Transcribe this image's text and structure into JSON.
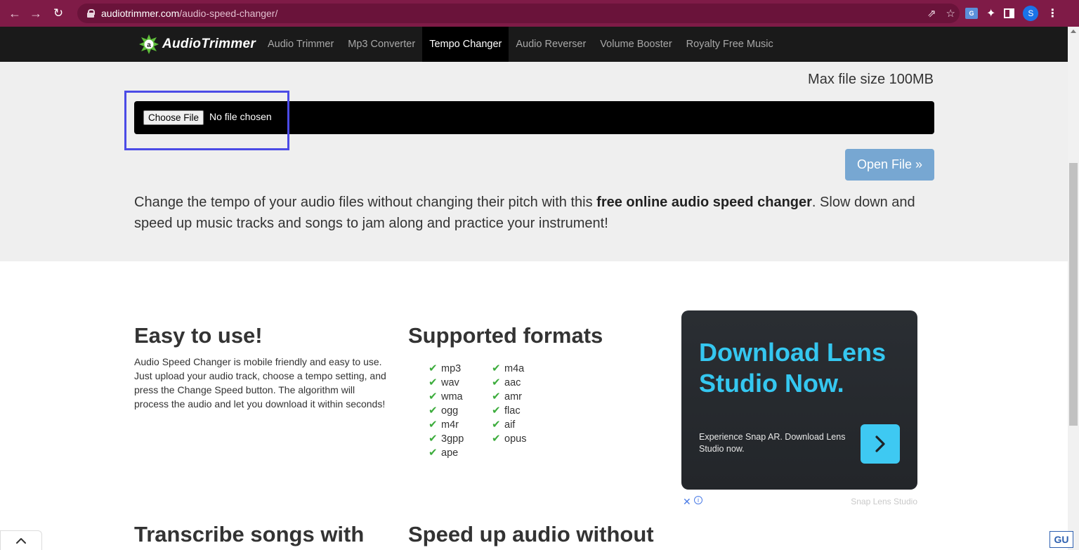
{
  "browser": {
    "url_host": "audiotrimmer.com",
    "url_path": "/audio-speed-changer/",
    "profile_initial": "S"
  },
  "site": {
    "logo_text": "AudioTrimmer",
    "nav": [
      {
        "label": "Audio Trimmer",
        "active": false
      },
      {
        "label": "Mp3 Converter",
        "active": false
      },
      {
        "label": "Tempo Changer",
        "active": true
      },
      {
        "label": "Audio Reverser",
        "active": false
      },
      {
        "label": "Volume Booster",
        "active": false
      },
      {
        "label": "Royalty Free Music",
        "active": false
      }
    ]
  },
  "hero": {
    "max_size": "Max file size 100MB",
    "choose_file_label": "Choose File",
    "no_file_text": "No file chosen",
    "open_file_label": "Open File »",
    "desc_pre": "Change the tempo of your audio files without changing their pitch with this ",
    "desc_bold": "free online audio speed changer",
    "desc_post": ". Slow down and speed up music tracks and songs to jam along and practice your instrument!"
  },
  "features": {
    "easy_title": "Easy to use!",
    "easy_text": "Audio Speed Changer is mobile friendly and easy to use. Just upload your audio track, choose a tempo setting, and press the Change Speed button. The algorithm will process the audio and let you download it within seconds!",
    "formats_title": "Supported formats",
    "formats_col1": [
      "mp3",
      "wav",
      "wma",
      "ogg",
      "m4r",
      "3gpp",
      "ape"
    ],
    "formats_col2": [
      "m4a",
      "aac",
      "amr",
      "flac",
      "aif",
      "opus"
    ],
    "transcribe_title": "Transcribe songs with",
    "speedup_title": "Speed up audio without"
  },
  "ad": {
    "headline": "Download Lens Studio Now.",
    "subtext": "Experience Snap AR. Download Lens Studio now.",
    "sponsor": "Snap Lens Studio",
    "close_glyph": "✕",
    "info_glyph": "i",
    "accent_color": "#35c7f0"
  },
  "watermark": "GU"
}
